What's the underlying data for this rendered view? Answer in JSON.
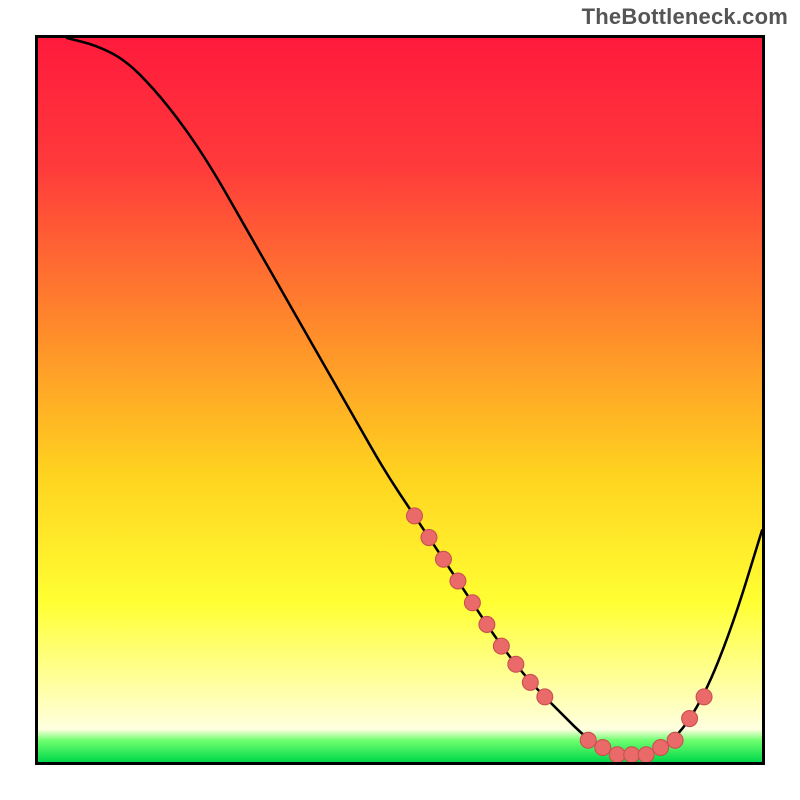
{
  "watermark": "TheBottleneck.com",
  "chart_data": {
    "type": "line",
    "title": "",
    "xlabel": "",
    "ylabel": "",
    "xlim": [
      0,
      100
    ],
    "ylim": [
      0,
      100
    ],
    "x": [
      4,
      8,
      12,
      16,
      20,
      24,
      28,
      32,
      36,
      40,
      44,
      48,
      52,
      56,
      60,
      64,
      68,
      72,
      76,
      80,
      84,
      88,
      92,
      96,
      100
    ],
    "values": [
      100,
      99,
      97,
      93,
      88,
      82,
      75,
      68,
      61,
      54,
      47,
      40,
      34,
      28,
      22,
      16,
      11,
      7,
      3,
      1,
      1,
      3,
      9,
      19,
      32
    ],
    "markers": {
      "x": [
        52,
        54,
        56,
        58,
        60,
        62,
        64,
        66,
        68,
        70,
        76,
        78,
        80,
        82,
        84,
        86,
        88,
        90,
        92
      ],
      "values": [
        34,
        31,
        28,
        25,
        22,
        19,
        16,
        13.5,
        11,
        9,
        3,
        2,
        1,
        1,
        1,
        2,
        3,
        6,
        9
      ]
    },
    "gradient_stops": [
      {
        "offset": 0.0,
        "color": "#ff1a3c"
      },
      {
        "offset": 0.18,
        "color": "#ff3b3b"
      },
      {
        "offset": 0.4,
        "color": "#ff8a2b"
      },
      {
        "offset": 0.6,
        "color": "#ffd21f"
      },
      {
        "offset": 0.78,
        "color": "#ffff33"
      },
      {
        "offset": 0.9,
        "color": "#ffffa8"
      },
      {
        "offset": 0.955,
        "color": "#ffffe0"
      },
      {
        "offset": 0.97,
        "color": "#6fff6f"
      },
      {
        "offset": 1.0,
        "color": "#00d84a"
      }
    ]
  }
}
